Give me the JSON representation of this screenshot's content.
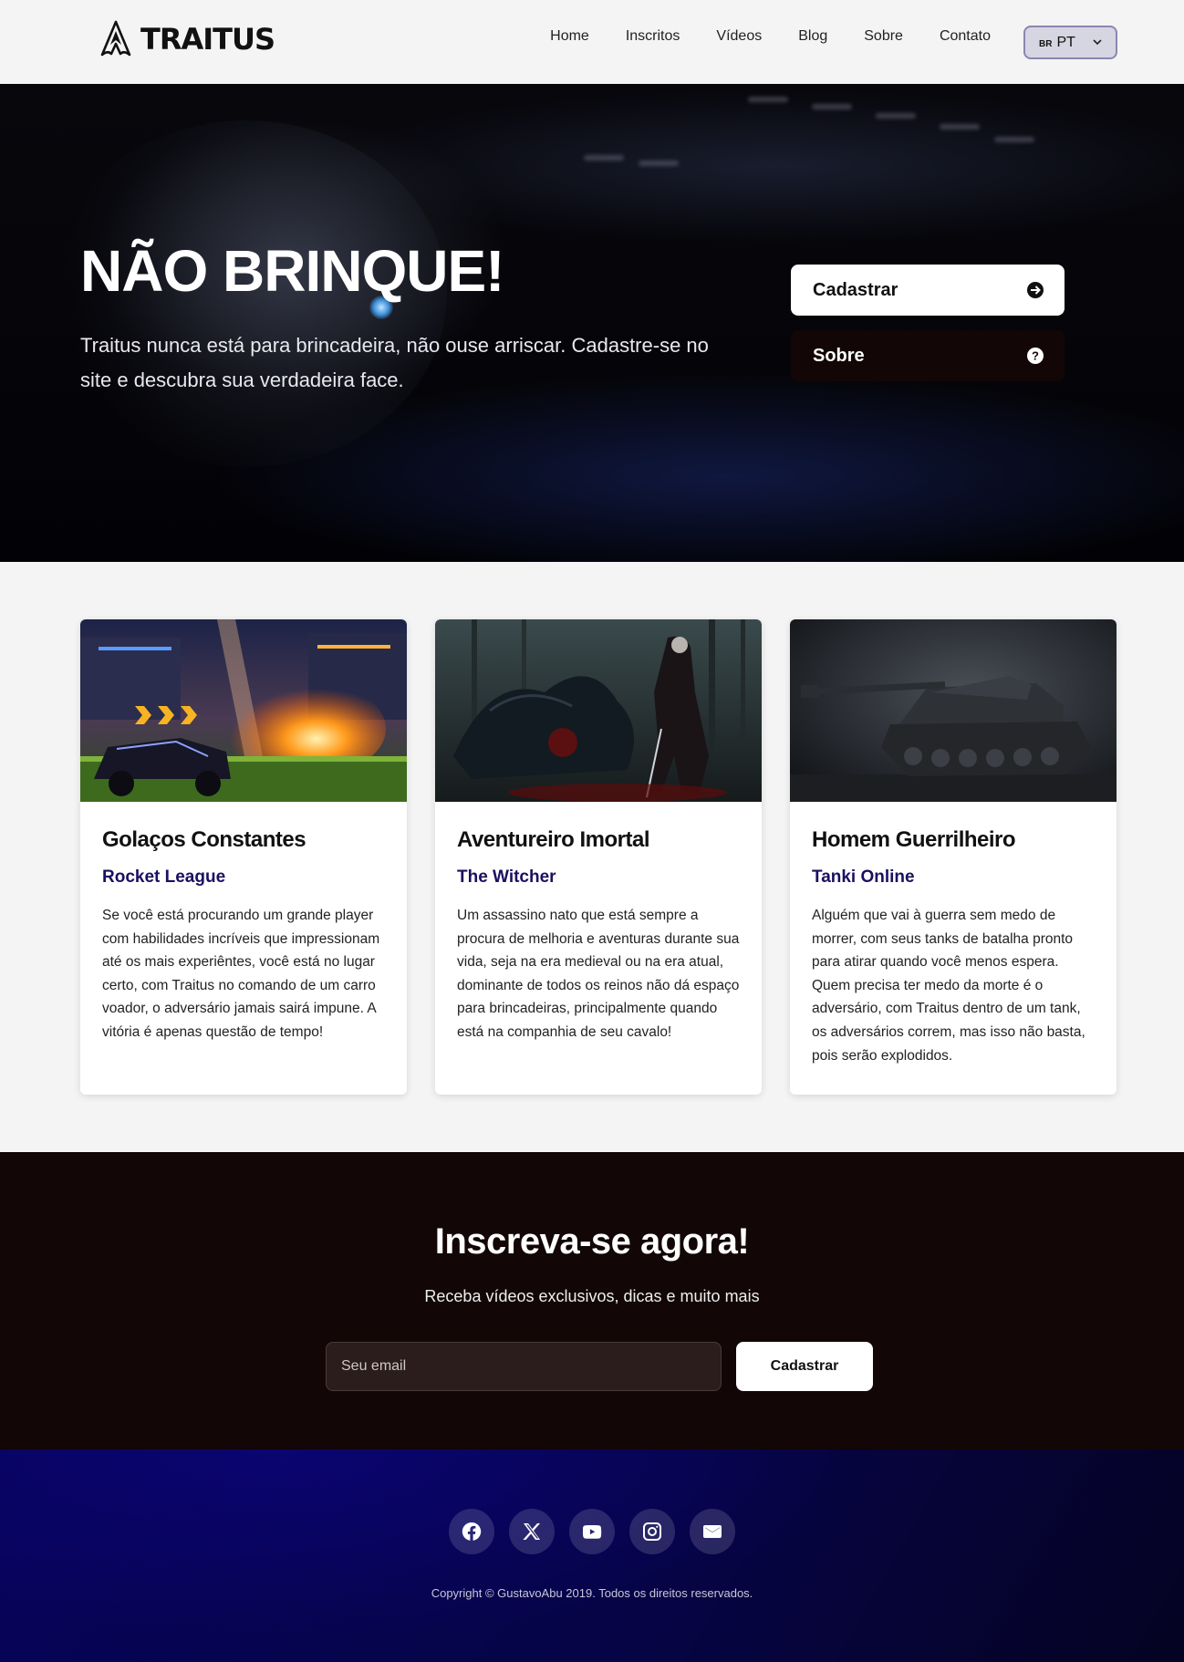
{
  "brand": {
    "name": "TRAITUS",
    "logo_icon": "assassin-symbol-icon"
  },
  "nav": {
    "links": [
      "Home",
      "Inscritos",
      "Vídeos",
      "Blog",
      "Sobre",
      "Contato"
    ],
    "language": {
      "flag": "BR",
      "code": "PT"
    }
  },
  "hero": {
    "title": "NÃO BRINQUE!",
    "text": "Traitus nunca está para brincadeira, não ouse arriscar. Cadastre-se no site e descubra sua verdadeira face.",
    "buttons": [
      {
        "label": "Cadastrar",
        "icon": "arrow-right-circle-icon"
      },
      {
        "label": "Sobre",
        "icon": "question-circle-icon"
      }
    ]
  },
  "cards": [
    {
      "title": "Golaços Constantes",
      "game": "Rocket League",
      "text": "Se você está procurando um grande player com habilidades incríveis que impressionam até os mais experiêntes, você está no lugar certo, com Traitus no comando de um carro voador, o adversário jamais sairá impune. A vitória é apenas questão de tempo!",
      "image": "rocket-league-image"
    },
    {
      "title": "Aventureiro Imortal",
      "game": "The Witcher",
      "text": "Um assassino nato que está sempre a procura de melhoria e aventuras durante sua vida, seja na era medieval ou na era atual, dominante de todos os reinos não dá espaço para brincadeiras, principalmente quando está na companhia de seu cavalo!",
      "image": "witcher-image"
    },
    {
      "title": "Homem Guerrilheiro",
      "game": "Tanki Online",
      "text": "Alguém que vai à guerra sem medo de morrer, com seus tanks de batalha pronto para atirar quando você menos espera. Quem precisa ter medo da morte é o adversário, com Traitus dentro de um tank, os adversários correm, mas isso não basta, pois serão explodidos.",
      "image": "tank-image"
    }
  ],
  "subscribe": {
    "title": "Inscreva-se agora!",
    "text": "Receba vídeos exclusivos, dicas e muito mais",
    "email_placeholder": "Seu email",
    "button": "Cadastrar"
  },
  "footer": {
    "socials": [
      "facebook-icon",
      "x-icon",
      "youtube-icon",
      "instagram-icon",
      "email-icon"
    ],
    "copyright": "Copyright © GustavoAbu 2019. Todos os direitos reservados."
  },
  "colors": {
    "accent_dark": "#120606",
    "game_title": "#1a1060",
    "footer_blue": "#07035a"
  }
}
